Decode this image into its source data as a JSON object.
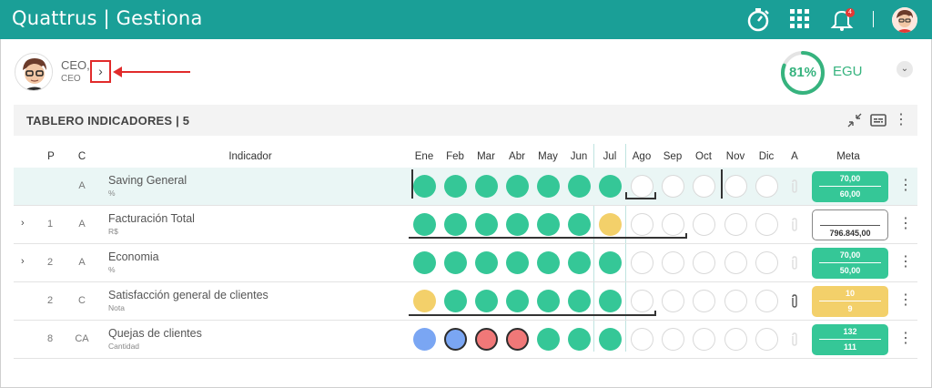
{
  "app": {
    "brand": "Quattrus | Gestiona",
    "notifications": "4"
  },
  "user": {
    "name": "CEO,",
    "role": "CEO",
    "expand_label": "›"
  },
  "summary": {
    "score": "81%",
    "score_value": 0.81,
    "unit": "EGU",
    "dropdown": "⌄"
  },
  "panel": {
    "title": "TABLERO INDICADORES | 5"
  },
  "columns": {
    "p": "P",
    "c": "C",
    "indicador": "Indicador",
    "months": [
      "Ene",
      "Feb",
      "Mar",
      "Abr",
      "May",
      "Jun",
      "Jul",
      "Ago",
      "Sep",
      "Oct",
      "Nov",
      "Dic"
    ],
    "a": "A",
    "meta": "Meta"
  },
  "rows": [
    {
      "p": "",
      "c": "A",
      "name": "Saving General",
      "unit": "%",
      "meta_top": "70,00",
      "meta_bottom": "60,00"
    },
    {
      "p": "1",
      "c": "A",
      "name": "Facturación Total",
      "unit": "R$",
      "meta_top": "",
      "meta_bottom": "796.845,00"
    },
    {
      "p": "2",
      "c": "A",
      "name": "Economia",
      "unit": "%",
      "meta_top": "70,00",
      "meta_bottom": "50,00"
    },
    {
      "p": "2",
      "c": "C",
      "name": "Satisfacción general de clientes",
      "unit": "Nota",
      "meta_top": "10",
      "meta_bottom": "9"
    },
    {
      "p": "8",
      "c": "CA",
      "name": "Quejas de clientes",
      "unit": "Cantidad",
      "meta_top": "132",
      "meta_bottom": "111"
    }
  ],
  "colors": {
    "topbar": "#1a9f97",
    "green": "#35c797",
    "yellow": "#f3d06a",
    "blue": "#7aa6f3",
    "red": "#f07878"
  },
  "icons": [
    "stopwatch-icon",
    "apps-grid-icon",
    "bell-icon",
    "compress-icon",
    "subtitles-icon",
    "kebab-icon",
    "paperclip-icon",
    "chevron-right-icon"
  ]
}
